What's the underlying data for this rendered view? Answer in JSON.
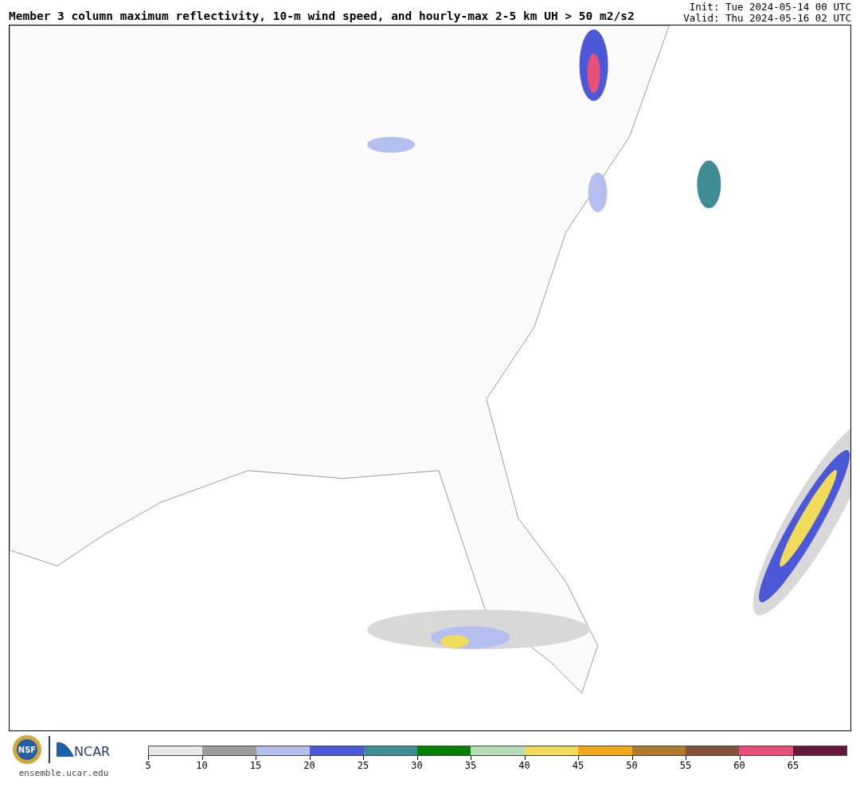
{
  "title": "Member 3 column maximum reflectivity, 10-m wind speed, and hourly-max 2-5 km UH > 50 m2/s2",
  "init": "Init: Tue 2024-05-14 00 UTC",
  "valid": "Valid: Thu 2024-05-16 02 UTC",
  "logos": {
    "nsf": "NSF",
    "ncar": "NCAR",
    "site": "ensemble.ucar.edu"
  },
  "colorbar": {
    "segments": [
      {
        "color": "#e8e8e8"
      },
      {
        "color": "#9c9c9c"
      },
      {
        "color": "#b4bff0"
      },
      {
        "color": "#4b58d8"
      },
      {
        "color": "#3f8d94"
      },
      {
        "color": "#008000"
      },
      {
        "color": "#b8dcb8"
      },
      {
        "color": "#f0dc5a"
      },
      {
        "color": "#f0a818"
      },
      {
        "color": "#b07a2c"
      },
      {
        "color": "#845238"
      },
      {
        "color": "#e8507a"
      },
      {
        "color": "#64183c"
      }
    ],
    "ticks": [
      "5",
      "10",
      "15",
      "20",
      "25",
      "30",
      "35",
      "40",
      "45",
      "50",
      "55",
      "60",
      "65"
    ]
  }
}
